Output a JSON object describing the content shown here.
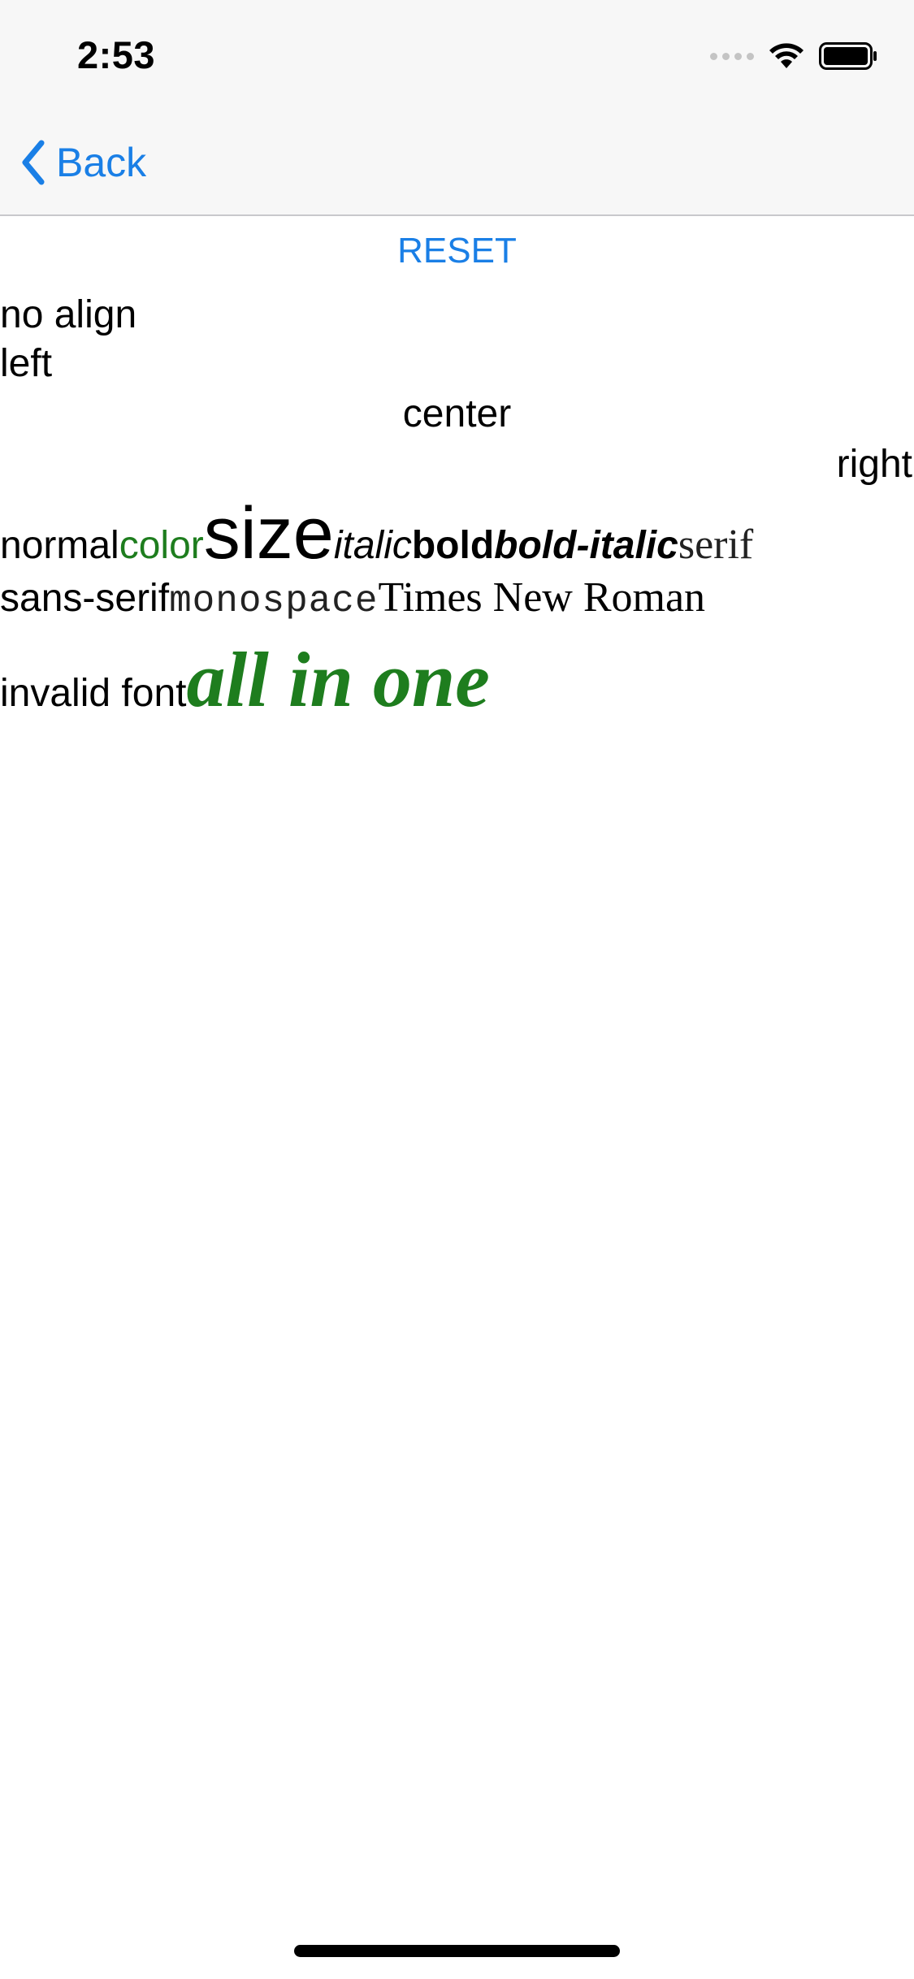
{
  "status_bar": {
    "time": "2:53"
  },
  "nav": {
    "back_label": "Back"
  },
  "reset_label": "RESET",
  "align_lines": {
    "no_align": "no align",
    "left": "left",
    "center": "center",
    "right": "right"
  },
  "style_row": {
    "normal": "normal",
    "color": "color",
    "size": "size",
    "italic": "italic",
    "bold": "bold",
    "bold_italic": "bold-italic",
    "serif": "serif"
  },
  "family_row": {
    "sans_serif": "sans-serif",
    "monospace": "monospace",
    "times": "Times New Roman"
  },
  "last_row": {
    "invalid_font": "invalid font",
    "all_in_one": "all in one"
  },
  "colors": {
    "accent": "#1a7fe6",
    "green": "#1e7d1e"
  }
}
